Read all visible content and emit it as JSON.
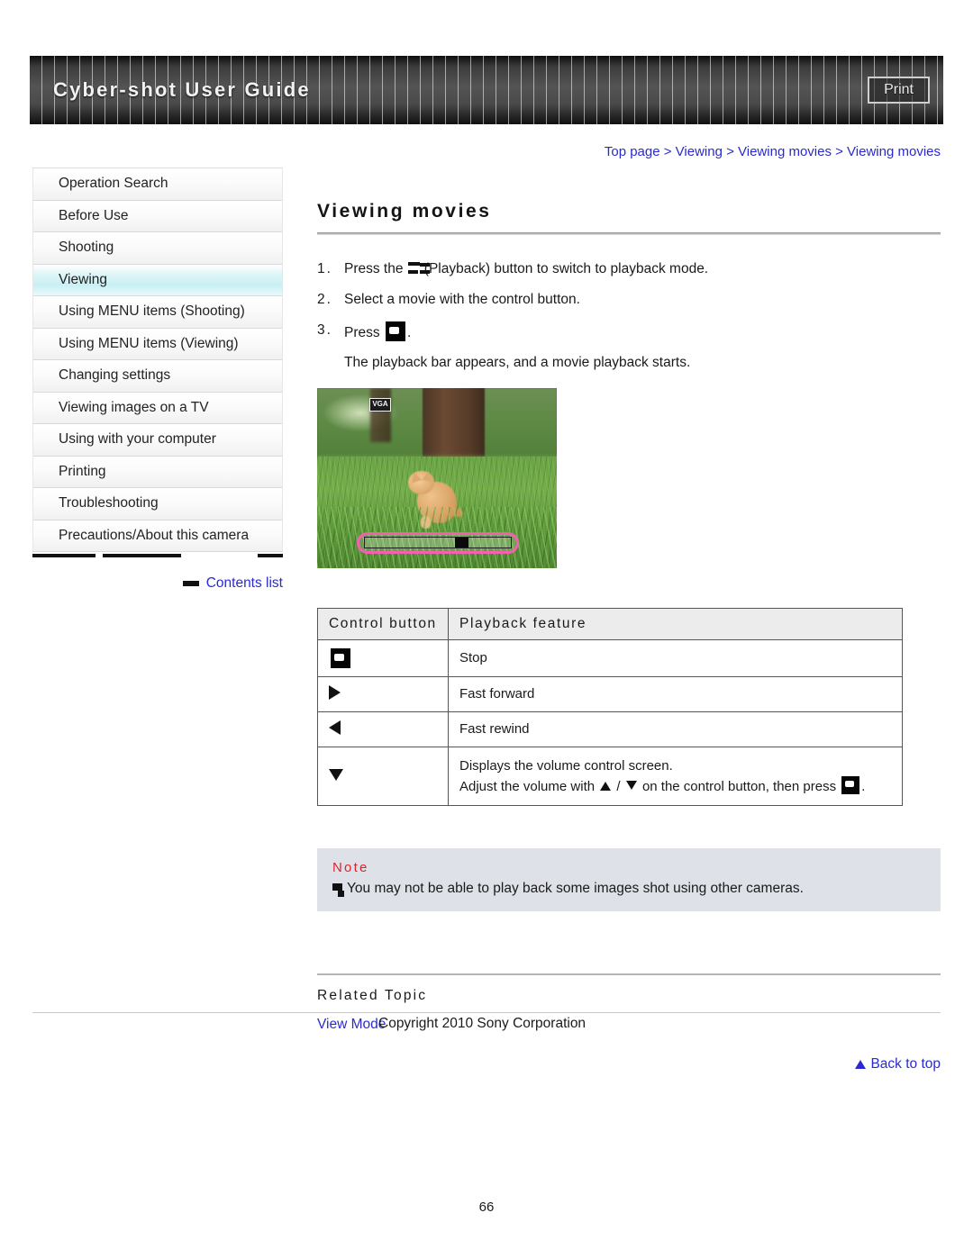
{
  "header": {
    "title": "Cyber-shot User Guide",
    "print_label": "Print"
  },
  "sidebar": {
    "items": [
      {
        "label": "Operation Search",
        "active": false
      },
      {
        "label": "Before Use",
        "active": false
      },
      {
        "label": "Shooting",
        "active": false
      },
      {
        "label": "Viewing",
        "active": true
      },
      {
        "label": "Using MENU items (Shooting)",
        "active": false
      },
      {
        "label": "Using MENU items (Viewing)",
        "active": false
      },
      {
        "label": "Changing settings",
        "active": false
      },
      {
        "label": "Viewing images on a TV",
        "active": false
      },
      {
        "label": "Using with your computer",
        "active": false
      },
      {
        "label": "Printing",
        "active": false
      },
      {
        "label": "Troubleshooting",
        "active": false
      },
      {
        "label": "Precautions/About this camera",
        "active": false
      }
    ],
    "contents_list_label": "Contents list"
  },
  "main": {
    "breadcrumb": "Top page > Viewing > Viewing movies > Viewing movies",
    "page_title": "Viewing movies",
    "steps": [
      {
        "num": "1.",
        "text_before": "Press the",
        "icon": "playback-icon",
        "text_after": "(Playback) button to switch to playback mode."
      },
      {
        "num": "2.",
        "text_before": "Select a movie with the control button.",
        "icon": "",
        "text_after": ""
      },
      {
        "num": "3.",
        "text_before": "Press",
        "icon": "center-button-icon",
        "text_after": ".",
        "sub": "The playback bar appears, and a movie playback starts."
      }
    ],
    "photo": {
      "badge": "VGA",
      "alt": "Movie playback screen showing a kitten on grass with playback bar"
    },
    "table": {
      "headers": [
        "Control button",
        "Playback feature"
      ],
      "rows": [
        {
          "icon": "center-button-icon",
          "feature": "Stop",
          "feature2": ""
        },
        {
          "icon": "right-triangle-icon",
          "feature": "Fast forward",
          "feature2": ""
        },
        {
          "icon": "left-triangle-icon",
          "feature": "Fast rewind",
          "feature2": ""
        },
        {
          "icon": "down-triangle-icon",
          "feature": "Displays the volume control screen.",
          "feature2_a": "Adjust the volume with",
          "feature2_b": "/",
          "feature2_c": "on the control button, then press",
          "feature2_d": "."
        }
      ]
    },
    "note": {
      "title": "Note",
      "items": [
        "You may not be able to play back some images shot using other cameras."
      ]
    },
    "related": {
      "title": "Related Topic",
      "links": [
        "View Mode"
      ]
    },
    "back_to_top": "Back to top"
  },
  "footer": {
    "copyright": "Copyright 2010 Sony Corporation",
    "page_number": "66"
  },
  "colors": {
    "link": "#2a2ad0",
    "note_title": "#d8262c",
    "active_sidebar": "#c9f0f4",
    "note_bg": "#dee2e8",
    "playback_bar_outline": "#f45fae"
  }
}
